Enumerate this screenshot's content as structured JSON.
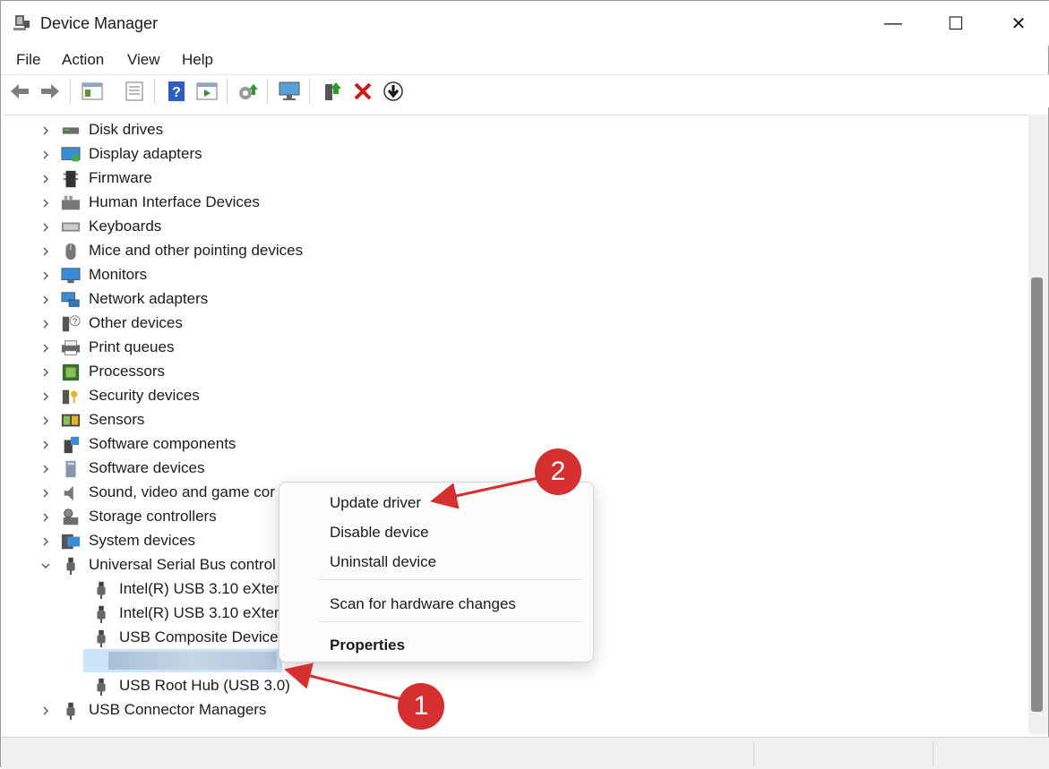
{
  "window": {
    "title": "Device Manager",
    "minimize": "—",
    "maximize": "☐",
    "close": "✕"
  },
  "menu": [
    "File",
    "Action",
    "View",
    "Help"
  ],
  "tree": [
    {
      "label": "Disk drives",
      "icon": "disk-icon"
    },
    {
      "label": "Display adapters",
      "icon": "display-icon"
    },
    {
      "label": "Firmware",
      "icon": "chip-icon"
    },
    {
      "label": "Human Interface Devices",
      "icon": "hid-icon"
    },
    {
      "label": "Keyboards",
      "icon": "keyboard-icon"
    },
    {
      "label": "Mice and other pointing devices",
      "icon": "mouse-icon"
    },
    {
      "label": "Monitors",
      "icon": "monitor-icon"
    },
    {
      "label": "Network adapters",
      "icon": "network-icon"
    },
    {
      "label": "Other devices",
      "icon": "unknown-device-icon"
    },
    {
      "label": "Print queues",
      "icon": "printer-icon"
    },
    {
      "label": "Processors",
      "icon": "processor-icon"
    },
    {
      "label": "Security devices",
      "icon": "security-icon"
    },
    {
      "label": "Sensors",
      "icon": "sensor-icon"
    },
    {
      "label": "Software components",
      "icon": "software-component-icon"
    },
    {
      "label": "Software devices",
      "icon": "software-device-icon"
    },
    {
      "label": "Sound, video and game cor",
      "icon": "speaker-icon"
    },
    {
      "label": "Storage controllers",
      "icon": "storage-icon"
    },
    {
      "label": "System devices",
      "icon": "system-icon"
    },
    {
      "label": "Universal Serial Bus control",
      "icon": "usb-icon",
      "expanded": true
    },
    {
      "label": "Intel(R) USB 3.10 eXtens",
      "icon": "usb-icon",
      "child": true
    },
    {
      "label": "Intel(R) USB 3.10 eXtens",
      "icon": "usb-icon",
      "child": true
    },
    {
      "label": "USB Composite Device",
      "icon": "usb-icon",
      "child": true
    },
    {
      "label": "",
      "icon": "usb-icon",
      "child": true,
      "selected": true
    },
    {
      "label": "USB Root Hub (USB 3.0)",
      "icon": "usb-icon",
      "child": true
    },
    {
      "label": "USB Connector Managers",
      "icon": "usb-icon"
    }
  ],
  "context_menu": {
    "update": "Update driver",
    "disable": "Disable device",
    "uninstall": "Uninstall device",
    "scan": "Scan for hardware changes",
    "properties": "Properties"
  },
  "annotations": {
    "badge1": "1",
    "badge2": "2",
    "accent": "#d62f2f"
  }
}
